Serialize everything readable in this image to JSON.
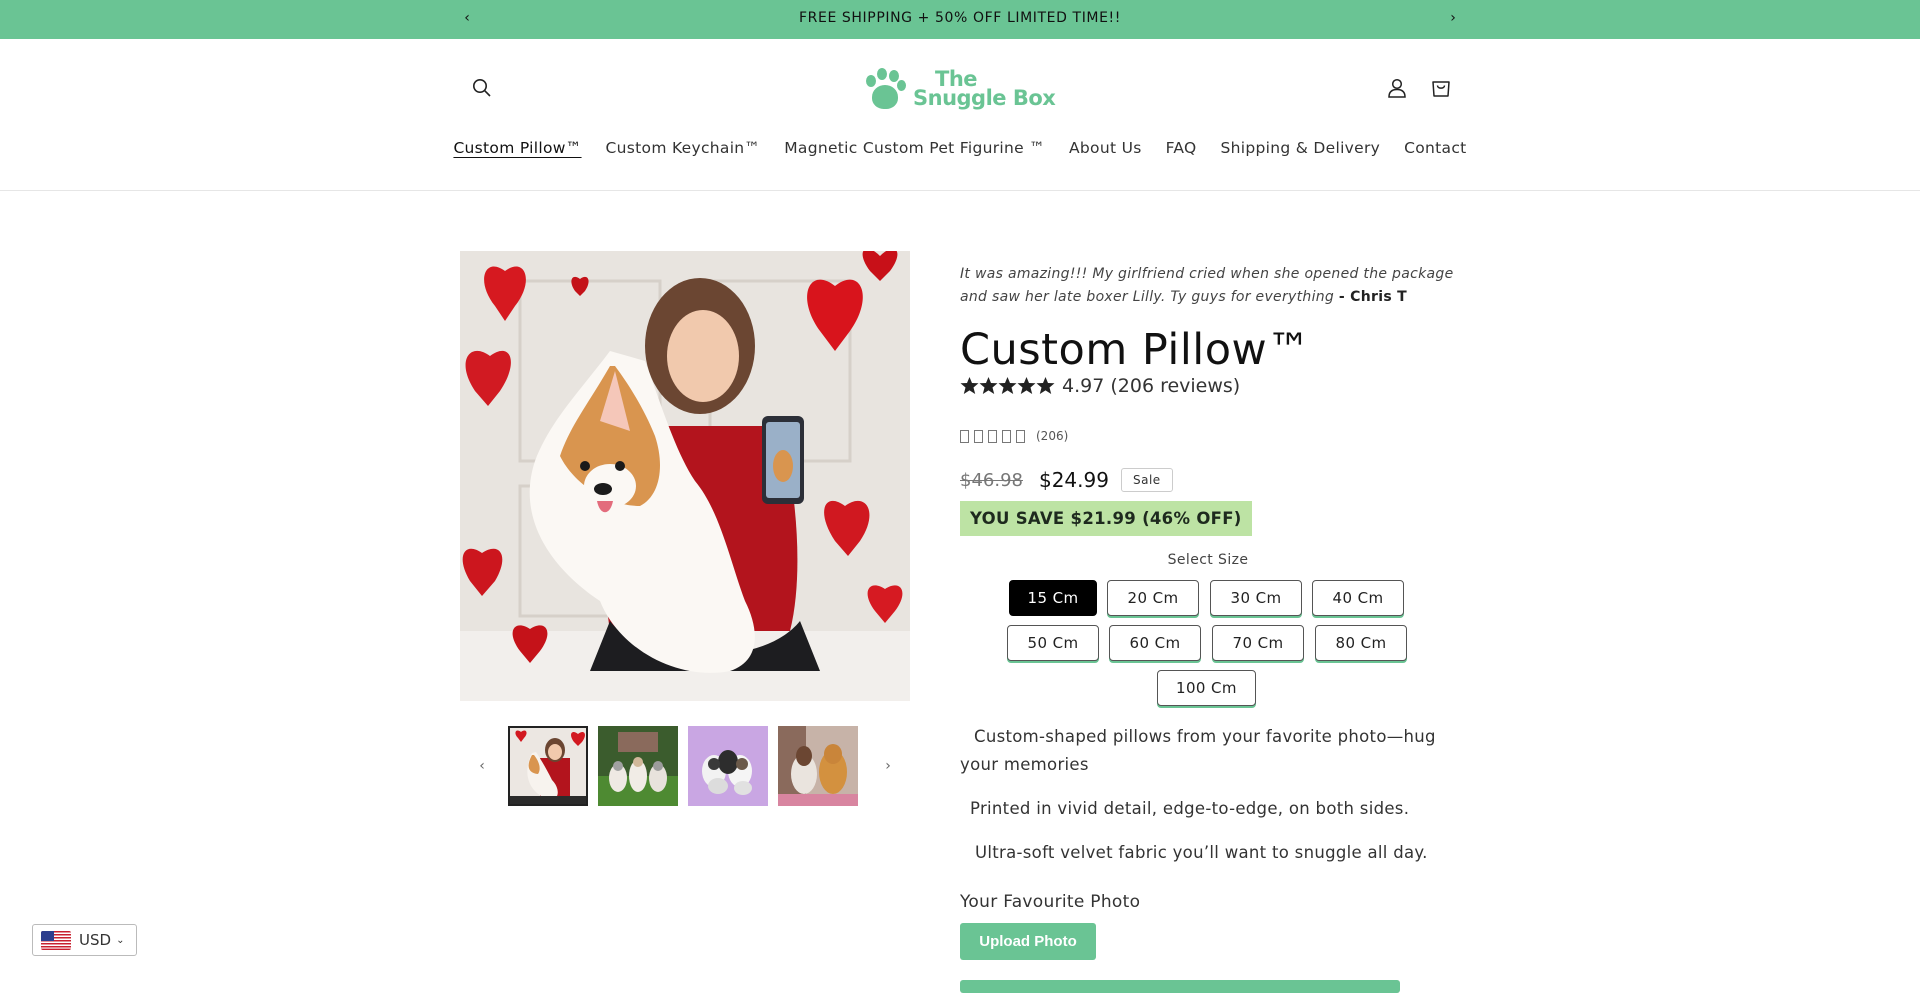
{
  "announcement": {
    "text": "FREE SHIPPING + 50% OFF LIMITED TIME!!",
    "prev_icon": "chevron-left-icon",
    "next_icon": "chevron-right-icon",
    "background": "#6ac494"
  },
  "header": {
    "logo_line1": "The",
    "logo_line2": "Snuggle Box",
    "brand_color": "#6ac494",
    "icons": [
      "search-icon",
      "account-icon",
      "cart-icon"
    ]
  },
  "nav": {
    "items": [
      {
        "label": "Custom Pillow™",
        "active": true
      },
      {
        "label": "Custom Keychain™",
        "active": false
      },
      {
        "label": "Magnetic Custom Pet Figurine ™",
        "active": false
      },
      {
        "label": "About Us",
        "active": false
      },
      {
        "label": "FAQ",
        "active": false
      },
      {
        "label": "Shipping & Delivery",
        "active": false
      },
      {
        "label": "Contact",
        "active": false
      }
    ]
  },
  "product": {
    "testimonial": "It was amazing!!! My girlfriend cried when she opened the package and saw her late boxer Lilly. Ty guys for everything",
    "testimonial_author": "- Chris T",
    "title": "Custom Pillow™",
    "rating": "4.97",
    "reviews_text": "(206 reviews)",
    "rating_stars": 5,
    "reviews_count_small": "(206)",
    "old_price": "$46.98",
    "price": "$24.99",
    "sale_badge": "Sale",
    "savings": "YOU SAVE $21.99 (46% OFF)",
    "size_label": "Select Size",
    "sizes": [
      "15 Cm",
      "20 Cm",
      "30 Cm",
      "40 Cm",
      "50 Cm",
      "60 Cm",
      "70 Cm",
      "80 Cm",
      "100 Cm"
    ],
    "selected_size": "15 Cm",
    "features": [
      "Custom-shaped pillows from your favorite photo—hug your memories",
      "Printed in vivid detail, edge-to-edge, on both sides.",
      "Ultra-soft velvet fabric you’ll want to snuggle all day."
    ],
    "photo_label": "Your Favourite Photo",
    "upload_label": "Upload Photo"
  },
  "gallery": {
    "thumbnails": [
      "thumbnail-girl-corgi-pillow",
      "thumbnail-dogs-garden",
      "thumbnail-dogs-purple",
      "thumbnail-girl-golden-retriever"
    ],
    "selected_index": 0
  },
  "currency": {
    "code": "USD",
    "flag": "us-flag-icon"
  }
}
